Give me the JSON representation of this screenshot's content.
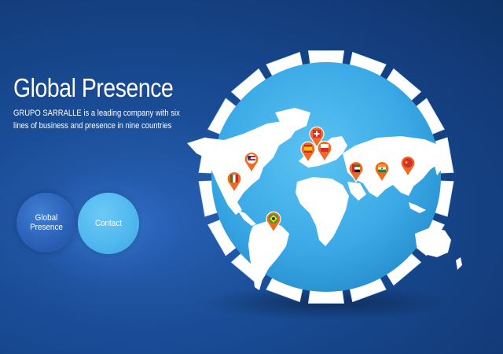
{
  "header": {
    "title": "Global Presence",
    "subtitle": "GRUPO SARRALLE is a leading company with six lines of business and presence in nine countries"
  },
  "nav": {
    "global_label": "Global Presence",
    "contact_label": "Contact"
  },
  "map": {
    "markers": [
      {
        "country": "USA",
        "icon": "usa-flag-icon"
      },
      {
        "country": "Mexico",
        "icon": "mexico-flag-icon"
      },
      {
        "country": "Brazil",
        "icon": "brazil-flag-icon"
      },
      {
        "country": "Spain",
        "icon": "spain-flag-icon"
      },
      {
        "country": "Switzerland",
        "icon": "switzerland-flag-icon"
      },
      {
        "country": "Poland",
        "icon": "poland-flag-icon"
      },
      {
        "country": "United Arab Emirates",
        "icon": "uae-flag-icon"
      },
      {
        "country": "India",
        "icon": "india-flag-icon"
      },
      {
        "country": "China",
        "icon": "china-flag-icon"
      }
    ]
  },
  "colors": {
    "background": "#1a4d97",
    "globe_ocean": "#3aa9e6",
    "globe_rim": "#ffffff",
    "marker": "#f06a22",
    "button_primary": "#2a5fb5",
    "button_secondary": "#4fb7ef"
  }
}
